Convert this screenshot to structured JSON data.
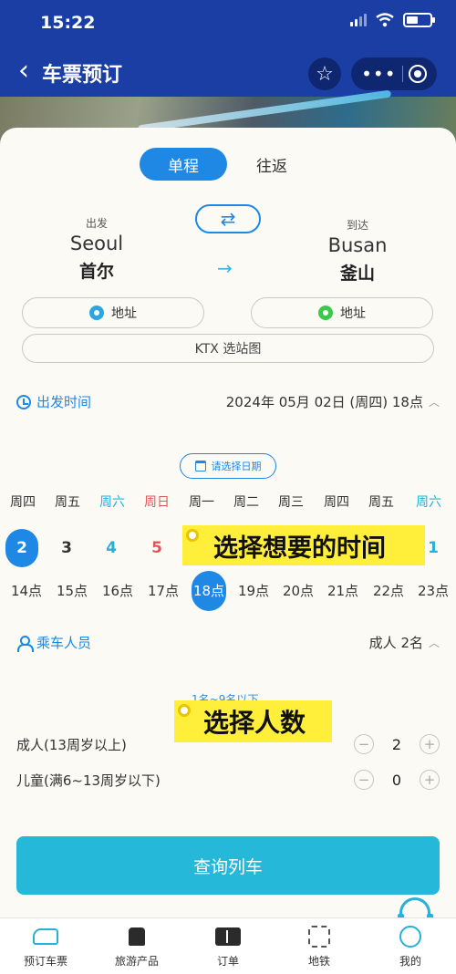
{
  "status_bar": {
    "time": "15:22"
  },
  "nav": {
    "back_icon": "chevron-left-icon",
    "title": "车票预订",
    "favorite_icon": "star-icon",
    "more_icon": "more-dots-icon",
    "close_icon": "target-icon"
  },
  "trip_type": {
    "tabs": [
      {
        "label": "单程",
        "selected": true
      },
      {
        "label": "往返",
        "selected": false
      }
    ]
  },
  "route": {
    "departure": {
      "label": "出发",
      "name_en": "Seoul",
      "name_cn": "首尔"
    },
    "arrival": {
      "label": "到达",
      "name_en": "Busan",
      "name_cn": "釜山"
    },
    "swap_icon": "swap-icon",
    "arrow_icon": "arrow-right-icon",
    "address_label": "地址",
    "map_label": "KTX 选站图"
  },
  "departure_time": {
    "label": "出发时间",
    "value": "2024年 05月 02日 (周四) 18点",
    "pick_date_label": "请选择日期"
  },
  "weekdays": [
    {
      "label": "周四",
      "color": "#333333"
    },
    {
      "label": "周五",
      "color": "#333333"
    },
    {
      "label": "周六",
      "color": "#27b0d8"
    },
    {
      "label": "周日",
      "color": "#e05656"
    },
    {
      "label": "周一",
      "color": "#333333"
    },
    {
      "label": "周二",
      "color": "#333333"
    },
    {
      "label": "周三",
      "color": "#333333"
    },
    {
      "label": "周四",
      "color": "#333333"
    },
    {
      "label": "周五",
      "color": "#333333"
    },
    {
      "label": "周六",
      "color": "#27b0d8"
    }
  ],
  "dates": [
    {
      "label": "2",
      "color": "#ffffff",
      "selected": true
    },
    {
      "label": "3",
      "color": "#333333"
    },
    {
      "label": "4",
      "color": "#27b0d8"
    },
    {
      "label": "5",
      "color": "#e05656"
    },
    {
      "label": "1",
      "color": "#27b0d8"
    }
  ],
  "hours": [
    "14点",
    "15点",
    "16点",
    "17点",
    "18点",
    "19点",
    "20点",
    "21点",
    "22点",
    "23点"
  ],
  "selected_hour_index": 4,
  "callouts": {
    "time": "选择想要的时间",
    "people": "选择人数"
  },
  "passengers": {
    "label": "乘车人员",
    "summary": "成人 2名",
    "hint": "1名~9名以下",
    "rows": [
      {
        "name": "成人(13周岁以上)",
        "value": "2",
        "minus": "−",
        "plus": "+"
      },
      {
        "name": "儿童(满6~13周岁以下)",
        "value": "0",
        "minus": "−",
        "plus": "+"
      }
    ]
  },
  "query_button": {
    "label": "查询列车"
  },
  "tabbar": [
    {
      "label": "预订车票",
      "icon": "train-icon"
    },
    {
      "label": "旅游产品",
      "icon": "bus-icon"
    },
    {
      "label": "订单",
      "icon": "ticket-icon"
    },
    {
      "label": "地铁",
      "icon": "metro-icon"
    },
    {
      "label": "我的",
      "icon": "profile-icon"
    }
  ],
  "support_icon": "customer-service-icon",
  "colors": {
    "brand_blue": "#1a3ea4",
    "accent_blue": "#1f88e5",
    "teal": "#25b8d8",
    "highlight": "#ffef3b"
  }
}
